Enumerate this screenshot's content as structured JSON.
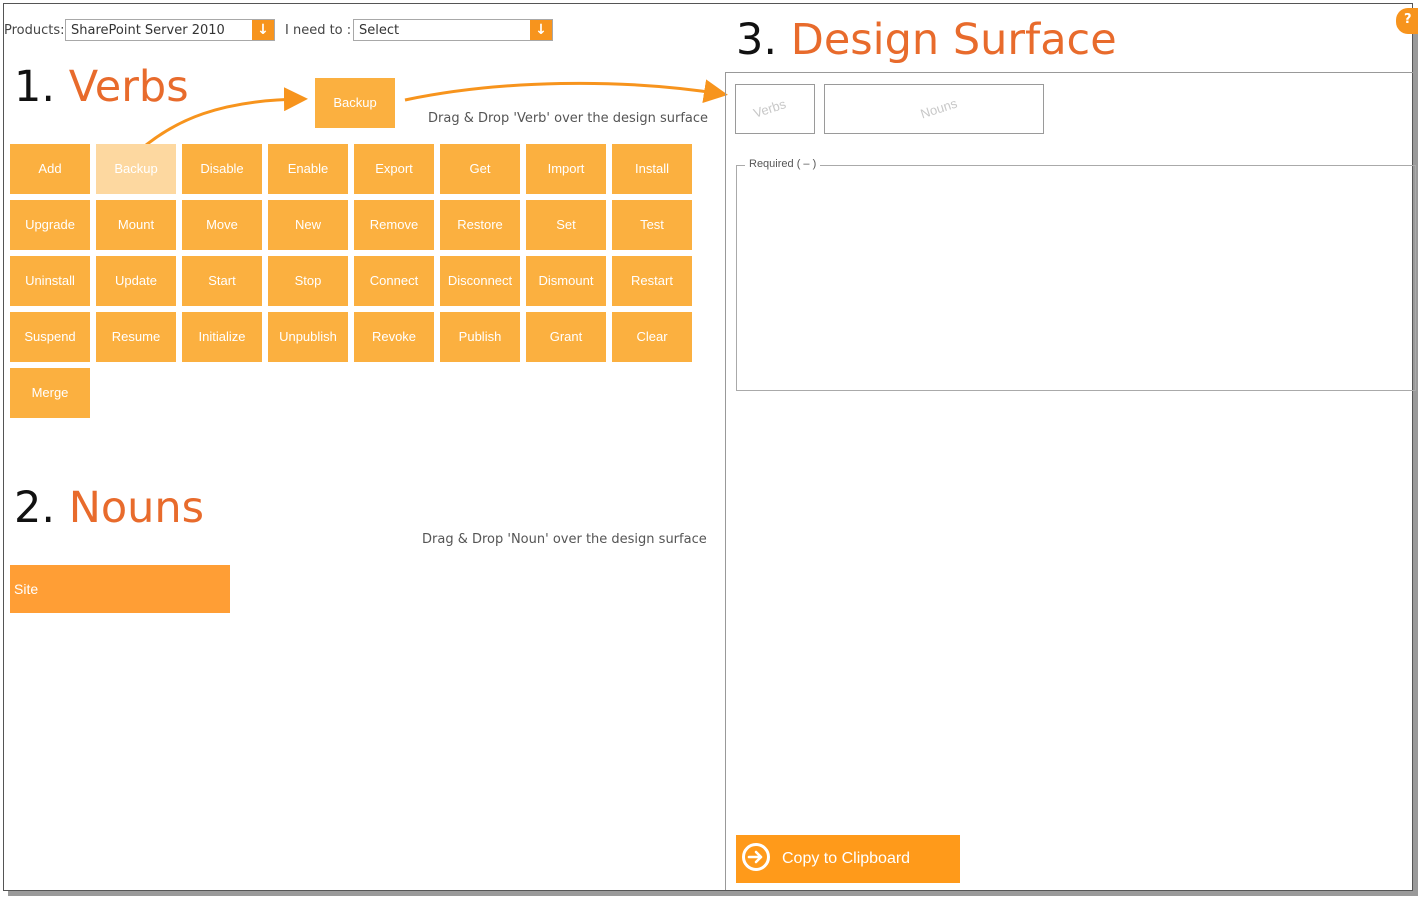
{
  "toolbar": {
    "products_label": "Products:",
    "products_value": "SharePoint Server 2010",
    "need_label": "I need to :",
    "need_value": "Select",
    "help_icon": "help-icon"
  },
  "verbs": {
    "num": "1.",
    "word": "Verbs",
    "drag_sample": "Backup",
    "hint": "Drag & Drop 'Verb' over the design surface",
    "items": [
      "Add",
      "Backup",
      "Disable",
      "Enable",
      "Export",
      "Get",
      "Import",
      "Install",
      "Upgrade",
      "Mount",
      "Move",
      "New",
      "Remove",
      "Restore",
      "Set",
      "Test",
      "Uninstall",
      "Update",
      "Start",
      "Stop",
      "Connect",
      "Disconnect",
      "Dismount",
      "Restart",
      "Suspend",
      "Resume",
      "Initialize",
      "Unpublish",
      "Revoke",
      "Publish",
      "Grant",
      "Clear",
      "Merge"
    ]
  },
  "nouns": {
    "num": "2.",
    "word": "Nouns",
    "hint": "Drag & Drop 'Noun' over the design surface",
    "items": [
      "Site"
    ]
  },
  "design": {
    "num": "3.",
    "word": "Design Surface",
    "verbs_placeholder": "Verbs",
    "nouns_placeholder": "Nouns",
    "required_label": "Required ( – )",
    "copy_label": "Copy to Clipboard"
  },
  "colors": {
    "tile": "#fbb040",
    "accent": "#f7941d",
    "heading": "#e86b2c"
  }
}
